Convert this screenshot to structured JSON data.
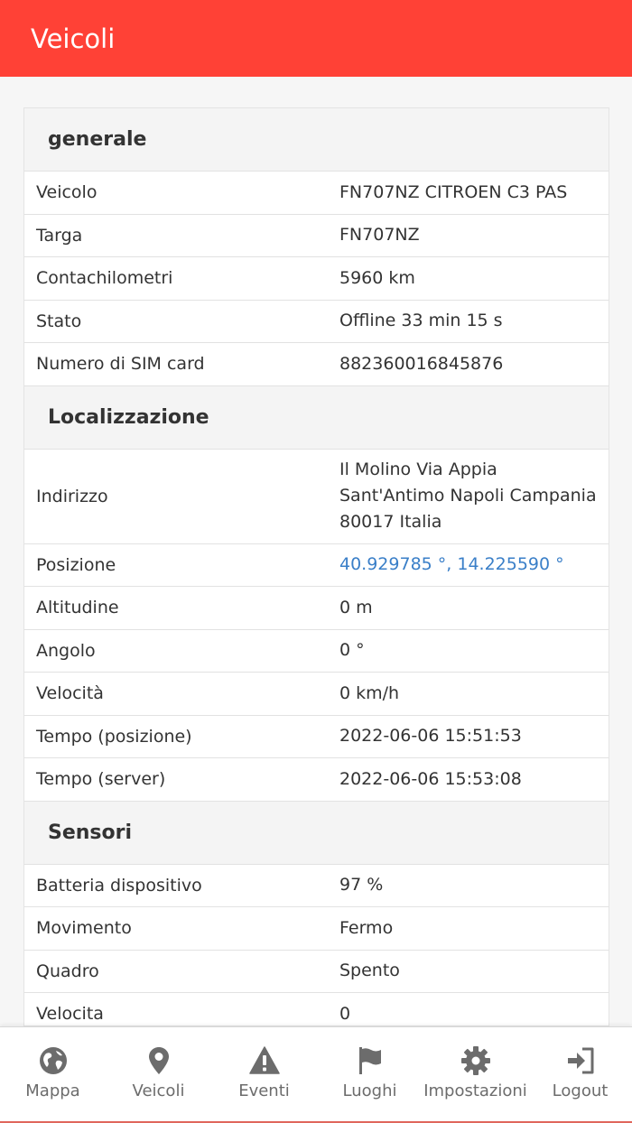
{
  "header": {
    "title": "Veicoli"
  },
  "sections": [
    {
      "title": "generale",
      "rows": [
        {
          "label": "Veicolo",
          "value": "FN707NZ CITROEN C3 PAS"
        },
        {
          "label": "Targa",
          "value": "FN707NZ"
        },
        {
          "label": "Contachilometri",
          "value": "5960 km"
        },
        {
          "label": "Stato",
          "value": "Offline 33 min 15 s"
        },
        {
          "label": "Numero di SIM card",
          "value": "882360016845876"
        }
      ]
    },
    {
      "title": "Localizzazione",
      "address": {
        "label": "Indirizzo",
        "lines": [
          "Il Molino Via Appia",
          "Sant'Antimo Napoli Campania",
          "80017 Italia"
        ]
      },
      "position": {
        "label": "Posizione",
        "value": "40.929785 °, 14.225590 °"
      },
      "rows": [
        {
          "label": "Altitudine",
          "value": "0 m"
        },
        {
          "label": "Angolo",
          "value": "0 °"
        },
        {
          "label": "Velocità",
          "value": "0 km/h"
        },
        {
          "label": "Tempo (posizione)",
          "value": "2022-06-06 15:51:53"
        },
        {
          "label": "Tempo (server)",
          "value": "2022-06-06 15:53:08"
        }
      ]
    },
    {
      "title": "Sensori",
      "rows": [
        {
          "label": "Batteria dispositivo",
          "value": "97 %"
        },
        {
          "label": "Movimento",
          "value": "Fermo"
        },
        {
          "label": "Quadro",
          "value": "Spento"
        },
        {
          "label": "Velocita",
          "value": "0"
        }
      ]
    }
  ],
  "nav": {
    "items": [
      {
        "label": "Mappa",
        "icon": "globe-icon"
      },
      {
        "label": "Veicoli",
        "icon": "map-pin-icon"
      },
      {
        "label": "Eventi",
        "icon": "warning-icon"
      },
      {
        "label": "Luoghi",
        "icon": "flag-icon"
      },
      {
        "label": "Impostazioni",
        "icon": "gear-icon"
      },
      {
        "label": "Logout",
        "icon": "sign-in-icon"
      }
    ]
  },
  "colors": {
    "header": "#ff4136",
    "link": "#3a7fc8",
    "nav_text": "#6c6c6c"
  }
}
